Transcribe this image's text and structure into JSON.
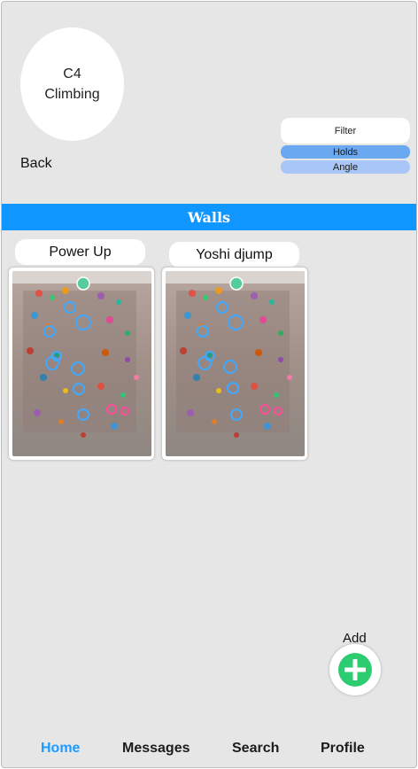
{
  "header": {
    "logo_line1": "C4",
    "logo_line2": "Climbing",
    "back_label": "Back"
  },
  "filter": {
    "label": "Filter",
    "chips": [
      "Holds",
      "Angle"
    ]
  },
  "section": {
    "title": "Walls"
  },
  "walls": [
    {
      "title": "Power Up",
      "image": "climbing-wall-photo"
    },
    {
      "title": "Yoshi djump",
      "image": "climbing-wall-photo"
    }
  ],
  "add": {
    "label": "Add",
    "icon": "plus-circle-icon",
    "color": "#2ecc71"
  },
  "tabs": [
    {
      "label": "Home",
      "active": true
    },
    {
      "label": "Messages",
      "active": false
    },
    {
      "label": "Search",
      "active": false
    },
    {
      "label": "Profile",
      "active": false
    }
  ],
  "colors": {
    "accent": "#0f97ff",
    "active_tab": "#1e9bff",
    "background": "#e6e6e6"
  }
}
